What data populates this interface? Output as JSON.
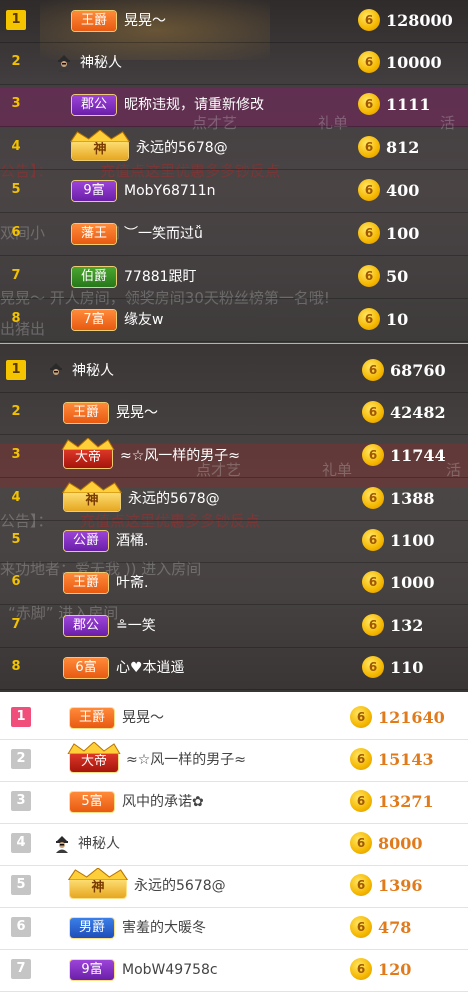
{
  "colors": {
    "rank_top_dark": "#f4c400",
    "rank_top_light": "#ef4f7a",
    "rank_normal_light": "#c5c5c5",
    "coin": "#f5b700",
    "amount_light": "#e07a1a"
  },
  "coin_icon_glyph": "6",
  "panels": [
    {
      "theme": "dark",
      "ghost_texts": [
        "公告】：",
        "充值点这里优惠多多钞反点",
        "双间小",
        "叫间",
        "晃晃～ 开人房间，领奖房间30天粉丝榜第一名哦!",
        "出猪出",
        "礼单",
        "点才艺",
        "活"
      ],
      "rows": [
        {
          "rank": "1",
          "badge": "王爵",
          "badge_color": "orange",
          "name": "晃晃～",
          "amount": "128000"
        },
        {
          "rank": "2",
          "badge": "",
          "avatar": "mystery-person-icon",
          "name": "神秘人",
          "amount": "10000"
        },
        {
          "rank": "3",
          "badge": "郡公",
          "badge_color": "purple",
          "name": "昵称违规，请重新修改",
          "amount": "1111"
        },
        {
          "rank": "4",
          "badge": "神",
          "badge_color": "gold",
          "name": "永远的5678@",
          "amount": "812"
        },
        {
          "rank": "5",
          "badge": "9富",
          "badge_color": "purple",
          "name": "MobY68711n",
          "amount": "400"
        },
        {
          "rank": "6",
          "badge": "藩王",
          "badge_color": "orange",
          "name": "︶一笑而过ǚ",
          "amount": "100"
        },
        {
          "rank": "7",
          "badge": "伯爵",
          "badge_color": "green",
          "name": "77881跟盯",
          "amount": "50"
        },
        {
          "rank": "8",
          "badge": "7富",
          "badge_color": "orange",
          "name": "缘友w",
          "amount": "10"
        }
      ]
    },
    {
      "theme": "dark",
      "ghost_texts": [
        "公告】：",
        "充值点这里优惠多多钞反点",
        "来功地者：爱无我 )) 进入房间",
        "“赤脚” 进入房间",
        "点才艺",
        "礼单",
        "活"
      ],
      "rows": [
        {
          "rank": "1",
          "badge": "",
          "avatar": "mystery-person-icon",
          "name": "神秘人",
          "amount": "68760"
        },
        {
          "rank": "2",
          "badge": "王爵",
          "badge_color": "orange",
          "name": "晃晃～",
          "amount": "42482"
        },
        {
          "rank": "3",
          "badge": "大帝",
          "badge_color": "red",
          "name": "≈☆风一样的男子≈",
          "amount": "11744"
        },
        {
          "rank": "4",
          "badge": "神",
          "badge_color": "gold",
          "name": "永远的5678@",
          "amount": "1388"
        },
        {
          "rank": "5",
          "badge": "公爵",
          "badge_color": "purple",
          "name": "酒桶.",
          "amount": "1100"
        },
        {
          "rank": "6",
          "badge": "王爵",
          "badge_color": "orange",
          "name": "叶斋.",
          "amount": "1000"
        },
        {
          "rank": "7",
          "badge": "郡公",
          "badge_color": "purple",
          "name": "≗一笑",
          "amount": "132"
        },
        {
          "rank": "8",
          "badge": "6富",
          "badge_color": "orange",
          "name": "心♥本逍遥",
          "amount": "110"
        }
      ]
    },
    {
      "theme": "light",
      "ghost_texts": [],
      "rows": [
        {
          "rank": "1",
          "badge": "王爵",
          "badge_color": "orange",
          "name": "晃晃～",
          "amount": "121640"
        },
        {
          "rank": "2",
          "badge": "大帝",
          "badge_color": "red",
          "name": "≈☆风一样的男子≈",
          "amount": "15143"
        },
        {
          "rank": "3",
          "badge": "5富",
          "badge_color": "orange",
          "name": "风中的承诺✿",
          "amount": "13271"
        },
        {
          "rank": "4",
          "badge": "",
          "avatar": "mystery-person-icon",
          "name": "神秘人",
          "amount": "8000"
        },
        {
          "rank": "5",
          "badge": "神",
          "badge_color": "gold",
          "name": "永远的5678@",
          "amount": "1396"
        },
        {
          "rank": "6",
          "badge": "男爵",
          "badge_color": "blue",
          "name": "害羞的大暖冬",
          "amount": "478"
        },
        {
          "rank": "7",
          "badge": "9富",
          "badge_color": "purple",
          "name": "MobW49758c",
          "amount": "120"
        }
      ]
    }
  ]
}
